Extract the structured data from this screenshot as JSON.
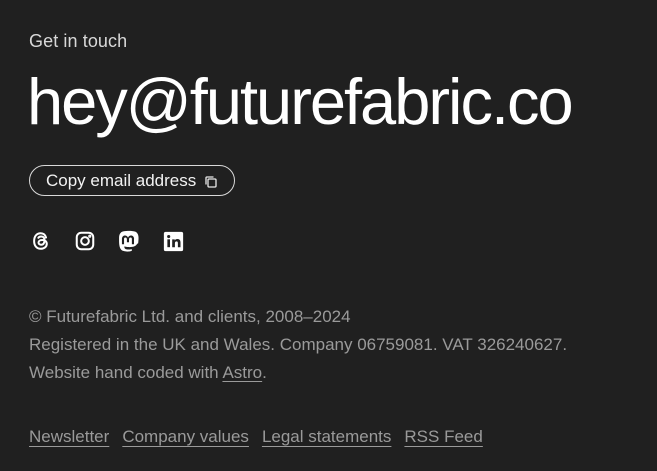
{
  "footer": {
    "eyebrow": "Get in touch",
    "email": "hey@futurefabric.co",
    "copy_button_label": "Copy email address",
    "social": [
      {
        "name": "threads-icon"
      },
      {
        "name": "instagram-icon"
      },
      {
        "name": "mastodon-icon"
      },
      {
        "name": "linkedin-icon"
      }
    ],
    "legal": {
      "copyright": "© Futurefabric Ltd. and clients, 2008–2024",
      "registration": "Registered in the UK and Wales. Company 06759081. VAT 326240627.",
      "built_with_prefix": "Website hand coded with ",
      "built_with_link": "Astro",
      "built_with_suffix": "."
    },
    "links": [
      "Newsletter",
      "Company values",
      "Legal statements",
      "RSS Feed"
    ]
  },
  "colors": {
    "background": "#202020",
    "text": "#ffffff",
    "muted": "#9a9a9a"
  }
}
